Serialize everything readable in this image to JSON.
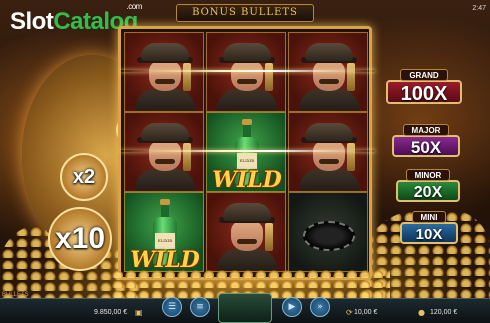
{
  "logo": {
    "slot": "Slot",
    "catalog": "Catalog",
    "com": ".com"
  },
  "clock": "2:47",
  "game_title": "BONUS BULLETS",
  "multipliers": {
    "small": "x2",
    "large": "x10"
  },
  "reels": [
    [
      "gangster",
      "gangster",
      "gangster"
    ],
    [
      "gangster",
      "wild-bottle",
      "gangster"
    ],
    [
      "wild-bottle",
      "gangster",
      "chips"
    ]
  ],
  "wild_label": "WILD",
  "bottle_label": "ELIXIR",
  "jackpots": {
    "grand": {
      "name": "GRAND",
      "value": "100X"
    },
    "major": {
      "name": "MAJOR",
      "value": "50X"
    },
    "minor": {
      "name": "MINOR",
      "value": "20X"
    },
    "mini": {
      "name": "MINI",
      "value": "10X"
    }
  },
  "footer": {
    "side_label": "BULLETS",
    "balance": "9.850,00 €",
    "win": "10,00 €",
    "bet": "120,00 €"
  },
  "colors": {
    "frame_gold": "#d9a445",
    "grand": "#9a1c2a",
    "major": "#8a2a90",
    "minor": "#2a8a3a",
    "mini": "#2a6aa0"
  }
}
